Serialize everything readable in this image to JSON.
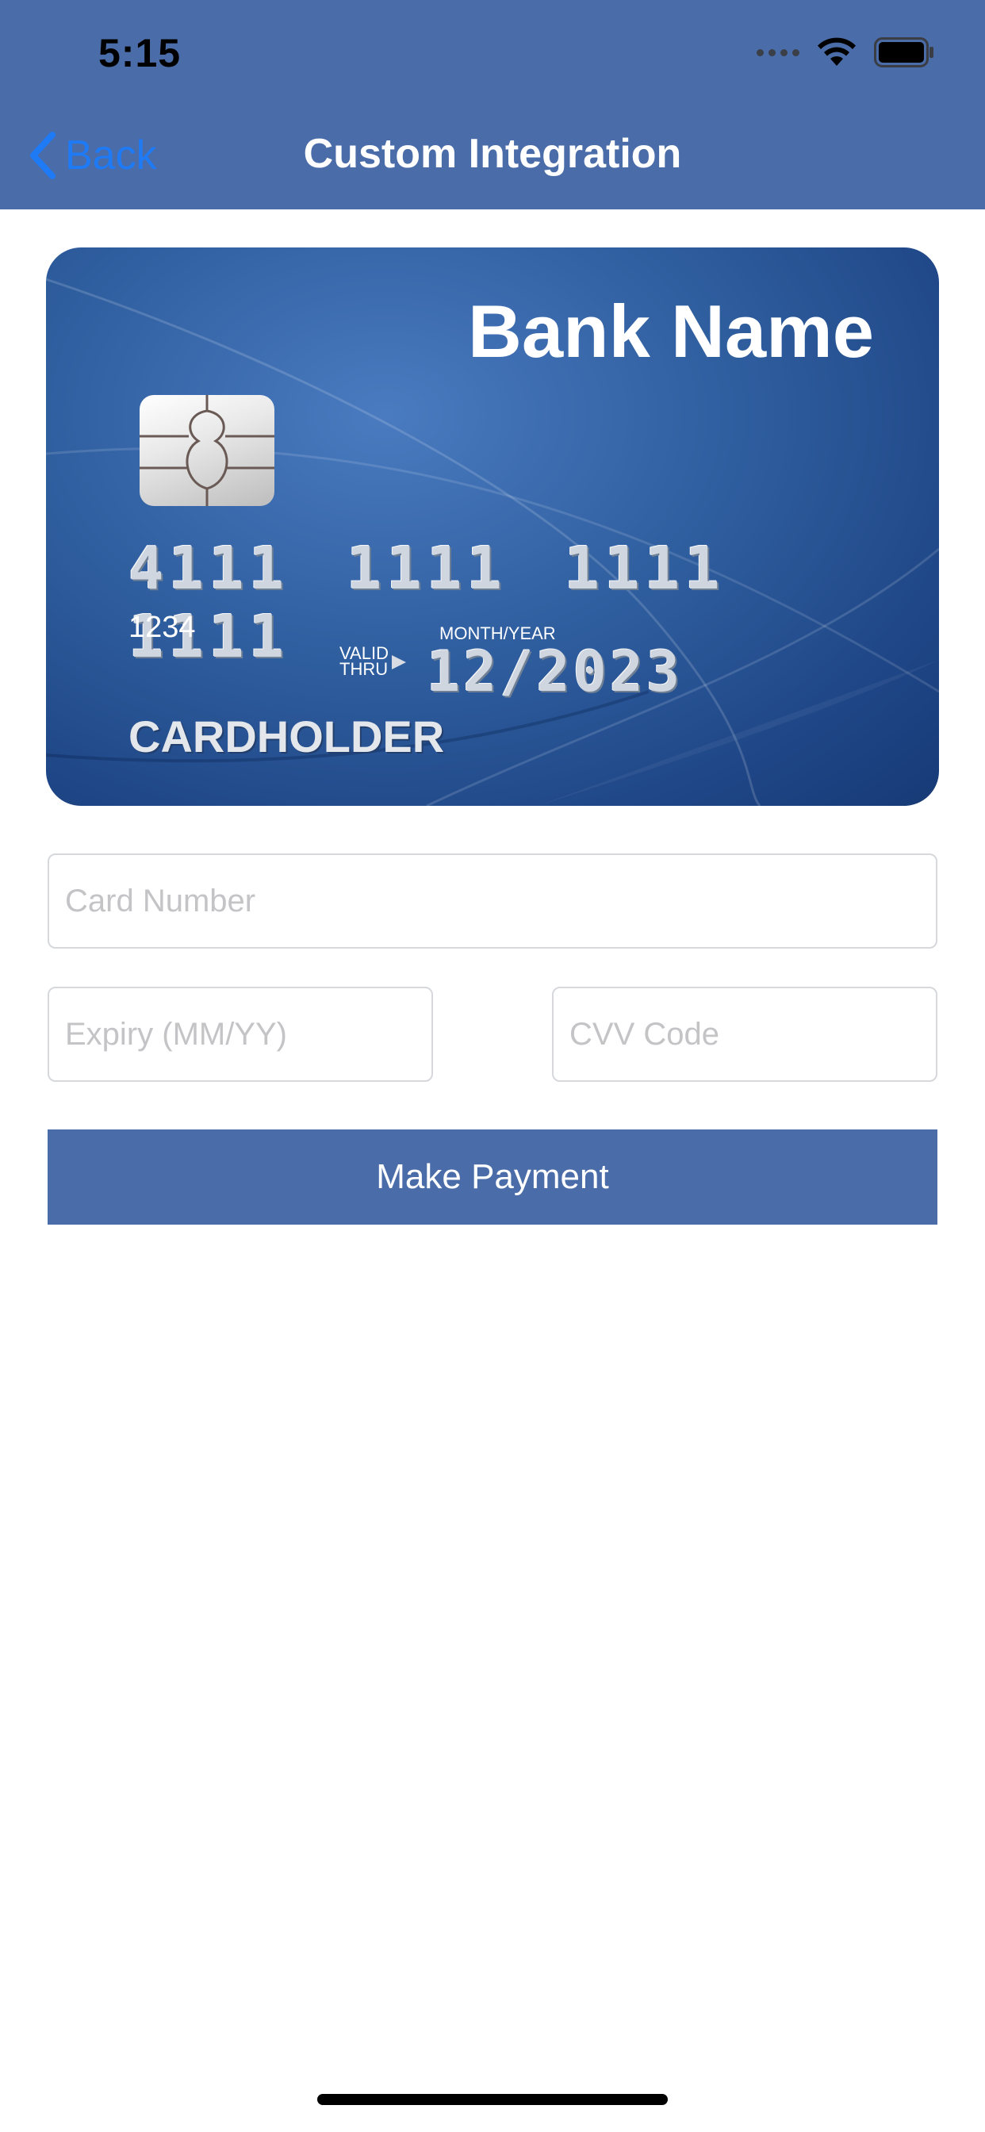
{
  "status_bar": {
    "time": "5:15"
  },
  "nav": {
    "back_label": "Back",
    "title": "Custom Integration"
  },
  "card": {
    "bank_name": "Bank Name",
    "number": "4111 1111 1111 1111",
    "small_number": "1234",
    "month_year_label": "MONTH/YEAR",
    "valid_thru_line1": "VALID",
    "valid_thru_line2": "THRU",
    "expiry": "12/2023",
    "holder": "CARDHOLDER"
  },
  "form": {
    "card_number_placeholder": "Card Number",
    "expiry_placeholder": "Expiry (MM/YY)",
    "cvv_placeholder": "CVV Code",
    "submit_label": "Make Payment"
  },
  "colors": {
    "nav_background": "#4a6ca8",
    "back_link": "#1f7af6",
    "button_background": "#4a6ca8"
  }
}
